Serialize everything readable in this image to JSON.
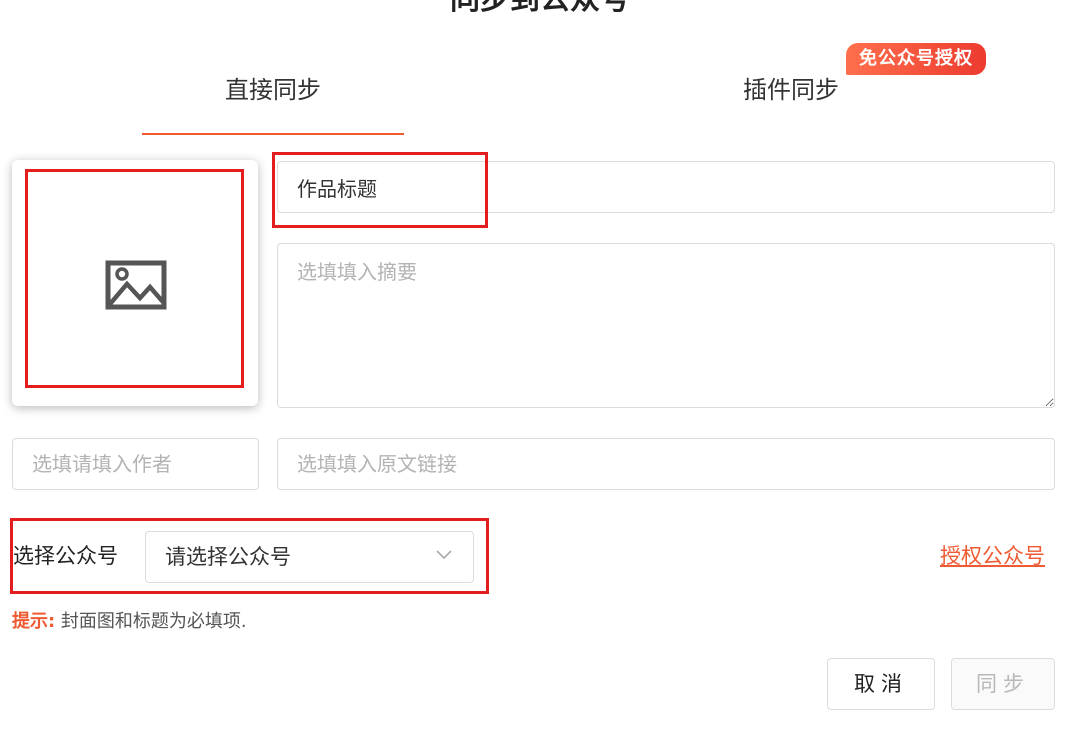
{
  "dialog": {
    "title": "同步到公众号"
  },
  "tabs": [
    {
      "label": "直接同步",
      "active": true
    },
    {
      "label": "插件同步",
      "active": false,
      "badge": "免公众号授权"
    }
  ],
  "form": {
    "cover_icon": "image-icon",
    "title_value": "作品标题",
    "summary_placeholder": "选填填入摘要",
    "author_placeholder": "选填请填入作者",
    "link_placeholder": "选填填入原文链接",
    "account_label": "选择公众号",
    "account_select_value": "请选择公众号",
    "authorize_link": "授权公众号",
    "hint_label": "提示:",
    "hint_text": " 封面图和标题为必填项."
  },
  "buttons": {
    "cancel": "取消",
    "sync": "同步"
  },
  "colors": {
    "accent": "#ef5a32",
    "highlight_frame": "#e31d1d",
    "badge_start": "#ff6f4c",
    "badge_end": "#ec3b2f"
  }
}
